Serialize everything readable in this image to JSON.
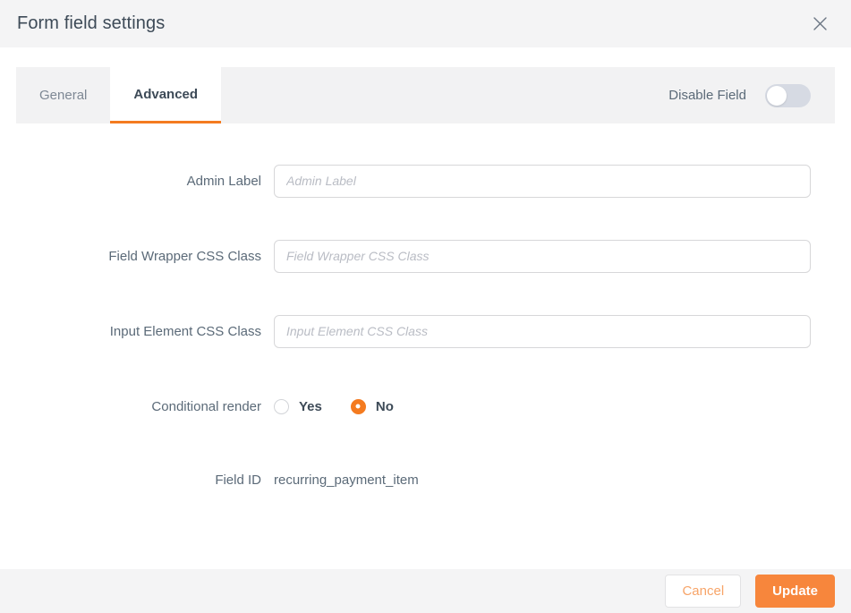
{
  "header": {
    "title": "Form field settings",
    "close_icon": "close-icon"
  },
  "tabs": [
    {
      "label": "General",
      "active": false
    },
    {
      "label": "Advanced",
      "active": true
    }
  ],
  "disable_field": {
    "label": "Disable Field",
    "state": "off"
  },
  "form": {
    "admin_label": {
      "label": "Admin Label",
      "placeholder": "Admin Label",
      "value": ""
    },
    "field_wrapper_css_class": {
      "label": "Field Wrapper CSS Class",
      "placeholder": "Field Wrapper CSS Class",
      "value": ""
    },
    "input_element_css_class": {
      "label": "Input Element CSS Class",
      "placeholder": "Input Element CSS Class",
      "value": ""
    },
    "conditional_render": {
      "label": "Conditional render",
      "options": [
        {
          "label": "Yes",
          "selected": false
        },
        {
          "label": "No",
          "selected": true
        }
      ]
    },
    "field_id": {
      "label": "Field ID",
      "value": "recurring_payment_item"
    }
  },
  "footer": {
    "cancel_label": "Cancel",
    "update_label": "Update"
  },
  "colors": {
    "accent": "#f47b20",
    "primary_button": "#f7863c",
    "header_bg": "#f4f4f5",
    "tab_inactive_bg": "#f2f2f3",
    "label_text": "#5b6a78",
    "title_text": "#3d4a57",
    "input_border": "#d7d7d9",
    "toggle_track": "#d6dae3"
  }
}
